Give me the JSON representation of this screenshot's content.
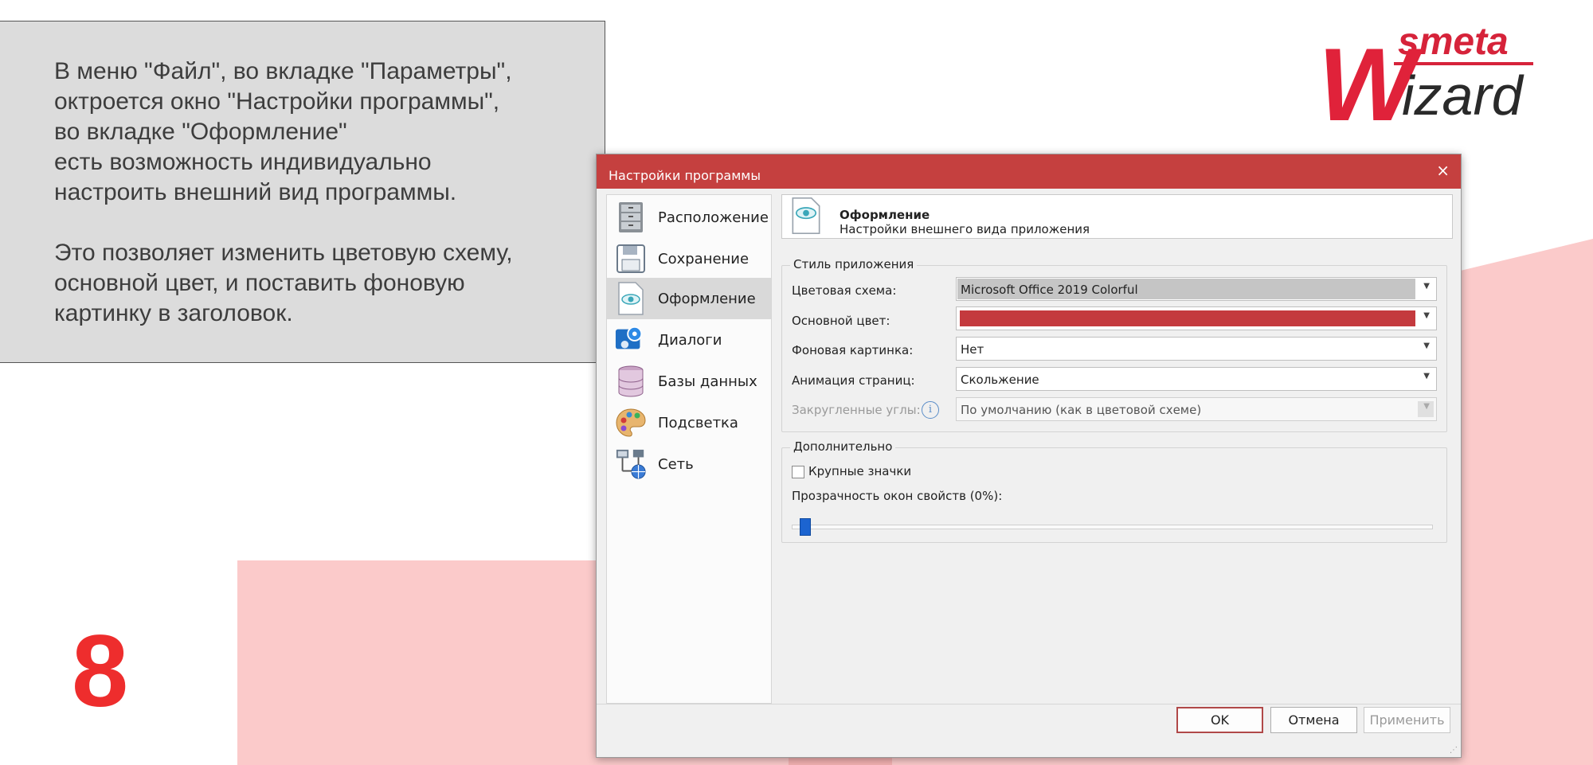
{
  "note": {
    "lines": [
      "В меню \"Файл\", во вкладке \"Параметры\",",
      "октроется окно \"Настройки программы\",",
      "во вкладке \"Оформление\"",
      "есть возможность индивидуально",
      "настроить внешний вид программы."
    ],
    "lines2": [
      "Это позволяет изменить цветовую схему,",
      "основной цвет, и поставить фоновую",
      "картинку в заголовок."
    ]
  },
  "slide_number": "8",
  "logo": {
    "top_text": "smeta",
    "bottom_text": "izard",
    "letter": "W"
  },
  "dialog": {
    "title": "Настройки программы",
    "close_glyph": "×",
    "nav": [
      {
        "label": "Расположение",
        "icon": "cabinet-icon"
      },
      {
        "label": "Сохранение",
        "icon": "floppy-disk-icon"
      },
      {
        "label": "Оформление",
        "icon": "eye-document-icon",
        "active": true
      },
      {
        "label": "Диалоги",
        "icon": "dialog-settings-icon"
      },
      {
        "label": "Базы данных",
        "icon": "database-icon"
      },
      {
        "label": "Подсветка",
        "icon": "palette-icon"
      },
      {
        "label": "Сеть",
        "icon": "network-icon"
      }
    ],
    "header": {
      "title": "Оформление",
      "subtitle": "Настройки внешнего вида приложения"
    },
    "style_group": {
      "title": "Стиль приложения",
      "color_scheme": {
        "label": "Цветовая схема:",
        "value": "Microsoft Office 2019 Colorful"
      },
      "main_color": {
        "label": "Основной цвет:",
        "value_color": "#c43a3e"
      },
      "background_image": {
        "label": "Фоновая картинка:",
        "value": "Нет"
      },
      "page_animation": {
        "label": "Анимация страниц:",
        "value": "Скольжение"
      },
      "rounded_corners": {
        "label": "Закругленные углы:",
        "value": "По умолчанию (как в цветовой схеме)",
        "info": "i"
      }
    },
    "extra_group": {
      "title": "Дополнительно",
      "large_icons": {
        "label": "Крупные значки",
        "checked": false
      },
      "transparency": {
        "label": "Прозрачность окон свойств (0%):",
        "value_percent": 0
      }
    },
    "buttons": {
      "ok": "OK",
      "cancel": "Отмена",
      "apply": "Применить"
    },
    "arrow_glyph": "▼"
  },
  "colors": {
    "accent": "#c5403f",
    "slide_number": "#ee2d2d",
    "pink_bg": "#fbcaca",
    "slider": "#1c64d0"
  }
}
